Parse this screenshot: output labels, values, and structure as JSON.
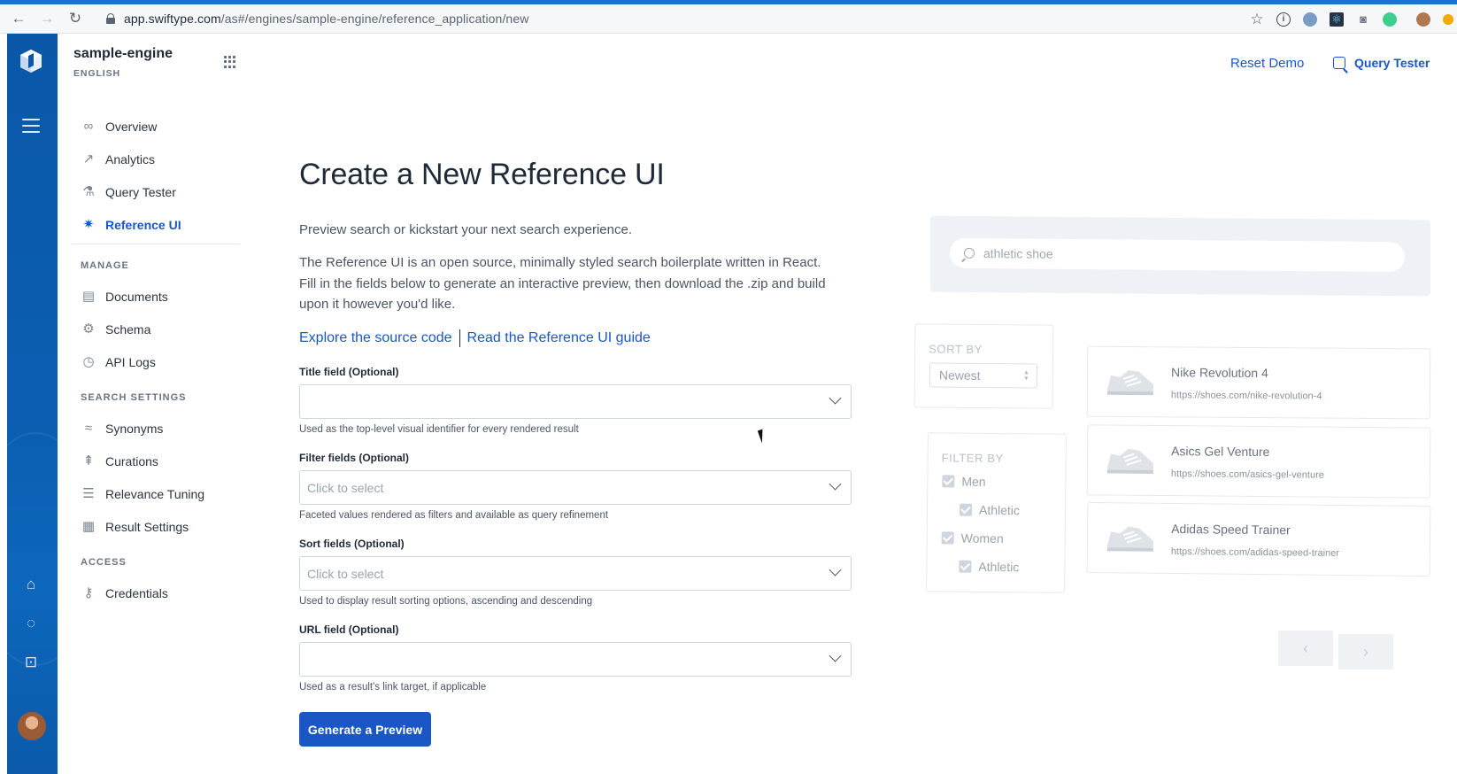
{
  "browser": {
    "url_host": "app.swiftype.com",
    "url_path": "/as#/engines/sample-engine/reference_application/new"
  },
  "sidebar": {
    "engine_name": "sample-engine",
    "engine_language": "ENGLISH",
    "nav_main": [
      {
        "label": "Overview",
        "icon": "binoculars-icon"
      },
      {
        "label": "Analytics",
        "icon": "chart-icon"
      },
      {
        "label": "Query Tester",
        "icon": "flask-icon"
      },
      {
        "label": "Reference UI",
        "icon": "magic-wand-icon",
        "active": true
      }
    ],
    "section_manage": "MANAGE",
    "nav_manage": [
      {
        "label": "Documents",
        "icon": "documents-icon"
      },
      {
        "label": "Schema",
        "icon": "gear-icon"
      },
      {
        "label": "API Logs",
        "icon": "clock-icon"
      }
    ],
    "section_search": "SEARCH SETTINGS",
    "nav_search": [
      {
        "label": "Synonyms",
        "icon": "wave-icon"
      },
      {
        "label": "Curations",
        "icon": "curations-icon"
      },
      {
        "label": "Relevance Tuning",
        "icon": "sliders-icon"
      },
      {
        "label": "Result Settings",
        "icon": "result-settings-icon"
      }
    ],
    "section_access": "ACCESS",
    "nav_access": [
      {
        "label": "Credentials",
        "icon": "key-icon"
      }
    ]
  },
  "header": {
    "reset_demo": "Reset Demo",
    "query_tester": "Query Tester"
  },
  "main": {
    "title": "Create a New Reference UI",
    "lead": "Preview search or kickstart your next search experience.",
    "description": "The Reference UI is an open source, minimally styled search boilerplate written in React. Fill in the fields below to generate an interactive preview, then download the .zip and build upon it however you'd like.",
    "link_source": "Explore the source code",
    "link_guide": "Read the Reference UI guide",
    "fields": {
      "title": {
        "label": "Title field (Optional)",
        "value": "",
        "hint": "Used as the top-level visual identifier for every rendered result"
      },
      "filter": {
        "label": "Filter fields (Optional)",
        "placeholder": "Click to select",
        "hint": "Faceted values rendered as filters and available as query refinement"
      },
      "sort": {
        "label": "Sort fields (Optional)",
        "placeholder": "Click to select",
        "hint": "Used to display result sorting options, ascending and descending"
      },
      "url": {
        "label": "URL field (Optional)",
        "value": "",
        "hint": "Used as a result's link target, if applicable"
      }
    },
    "generate_button": "Generate a Preview"
  },
  "preview": {
    "search_placeholder": "athletic shoe",
    "sort_label": "SORT BY",
    "sort_value": "Newest",
    "filter_label": "FILTER BY",
    "filters": [
      {
        "label": "Men",
        "checked": true,
        "level": 0
      },
      {
        "label": "Athletic",
        "checked": true,
        "level": 1
      },
      {
        "label": "Women",
        "checked": true,
        "level": 0
      },
      {
        "label": "Athletic",
        "checked": true,
        "level": 1
      }
    ],
    "results": [
      {
        "name": "Nike Revolution 4",
        "url": "https://shoes.com/nike-revolution-4"
      },
      {
        "name": "Asics Gel Venture",
        "url": "https://shoes.com/asics-gel-venture"
      },
      {
        "name": "Adidas Speed Trainer",
        "url": "https://shoes.com/adidas-speed-trainer"
      }
    ],
    "prev_arrow": "‹",
    "next_arrow": "›"
  },
  "colors": {
    "brand_blue": "#1a56c4",
    "rail_blue": "#0a57a8"
  }
}
